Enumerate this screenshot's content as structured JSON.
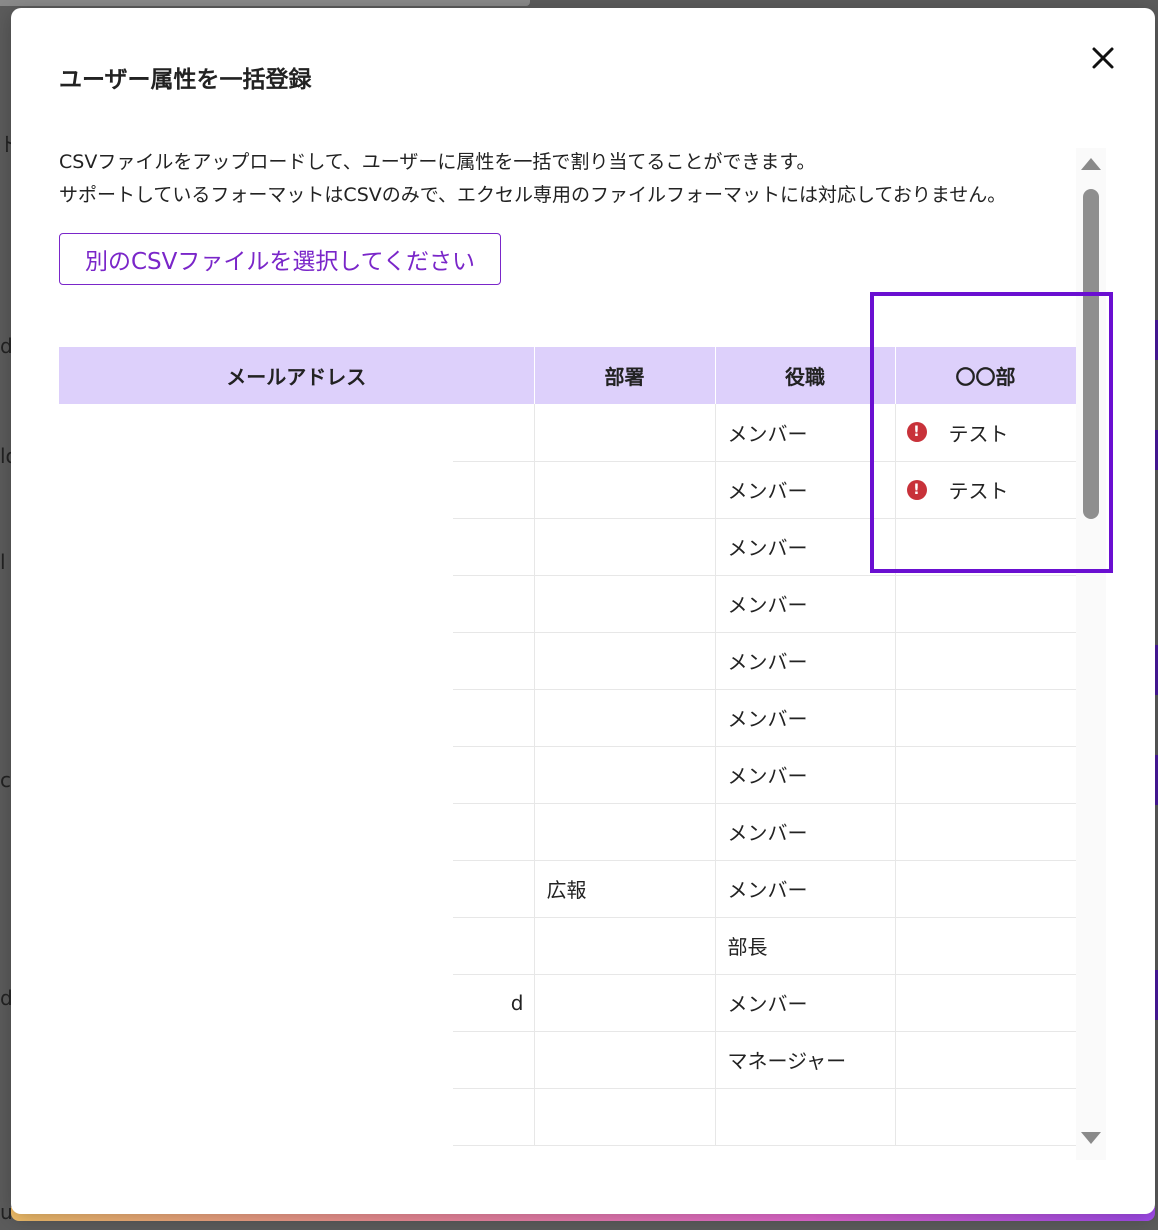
{
  "background": {
    "left_edge_glyphs": [
      "ド",
      "d",
      "lo",
      "l",
      "cl",
      "d",
      "u"
    ],
    "bottom_fragments": [
      "…",
      "…"
    ]
  },
  "modal": {
    "title": "ユーザー属性を一括登録",
    "close_label": "✕",
    "description_line1": "CSVファイルをアップロードして、ユーザーに属性を一括で割り当てることができます。",
    "description_line2": "サポートしているフォーマットはCSVのみで、エクセル専用のファイルフォーマットには対応しておりません。",
    "select_button_label": "別のCSVファイルを選択してください"
  },
  "table": {
    "headers": [
      "メールアドレス",
      "部署",
      "役職",
      "〇〇部"
    ],
    "rows": [
      {
        "email": "",
        "department": "",
        "position": "メンバー",
        "attr": "テスト",
        "error": true
      },
      {
        "email": "",
        "department": "",
        "position": "メンバー",
        "attr": "テスト",
        "error": true
      },
      {
        "email": "",
        "department": "",
        "position": "メンバー",
        "attr": "",
        "error": false
      },
      {
        "email": "",
        "department": "",
        "position": "メンバー",
        "attr": "",
        "error": false
      },
      {
        "email": "",
        "department": "",
        "position": "メンバー",
        "attr": "",
        "error": false
      },
      {
        "email": "",
        "department": "",
        "position": "メンバー",
        "attr": "",
        "error": false
      },
      {
        "email": "",
        "department": "",
        "position": "メンバー",
        "attr": "",
        "error": false
      },
      {
        "email": "",
        "department": "",
        "position": "メンバー",
        "attr": "",
        "error": false
      },
      {
        "email": "",
        "department": "広報",
        "position": "メンバー",
        "attr": "",
        "error": false
      },
      {
        "email": "",
        "department": "",
        "position": "部長",
        "attr": "",
        "error": false
      },
      {
        "email": "d",
        "department": "",
        "position": "メンバー",
        "attr": "",
        "error": false
      },
      {
        "email": "",
        "department": "",
        "position": "マネージャー",
        "attr": "",
        "error": false
      },
      {
        "email": "",
        "department": "",
        "position": "",
        "attr": "",
        "error": false
      }
    ]
  },
  "colors": {
    "accent": "#7a26c9",
    "header_bg": "#ddd0fb",
    "highlight": "#6a0fd1",
    "error": "#c8323a"
  },
  "icons": {
    "error": "exclamation-circle-icon",
    "close": "close-icon"
  }
}
